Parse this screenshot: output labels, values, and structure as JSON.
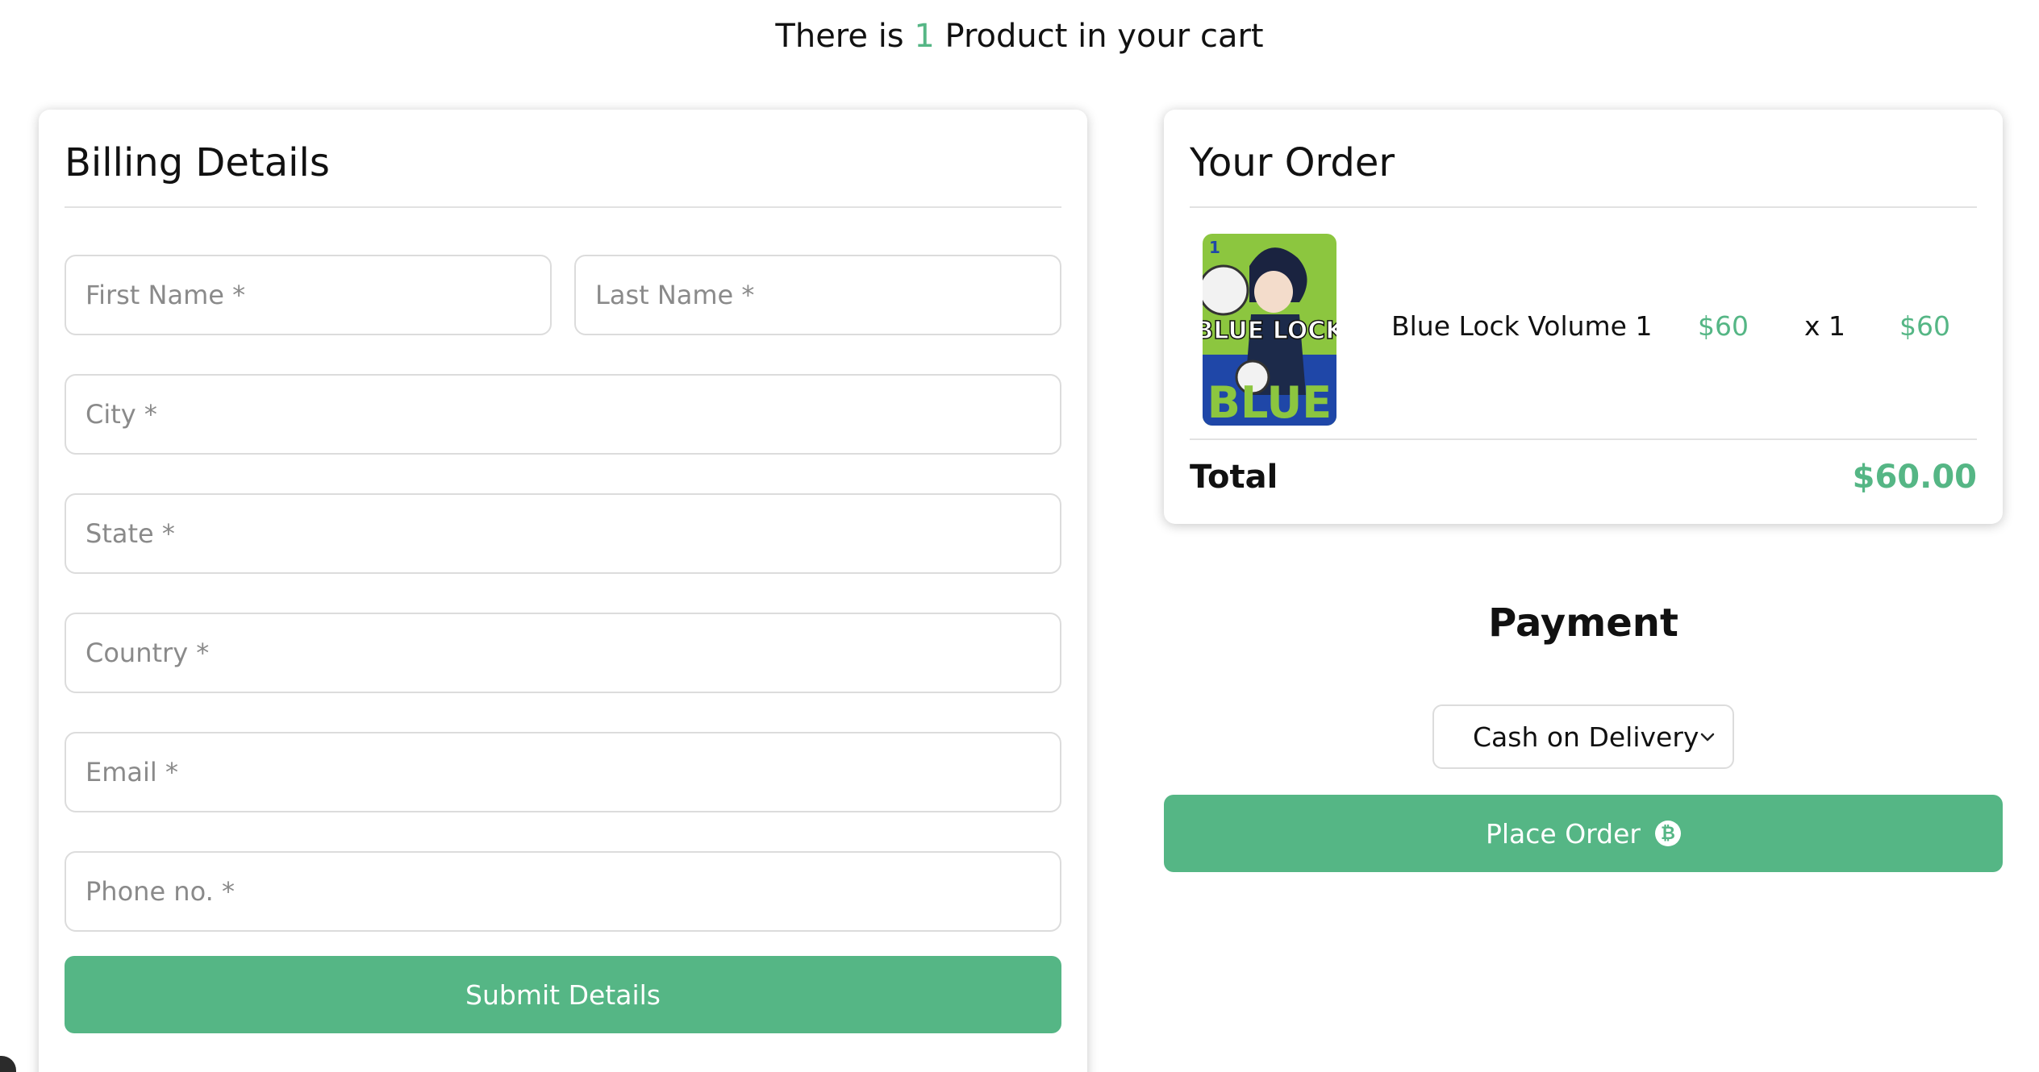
{
  "header": {
    "prefix": "There is ",
    "count": "1",
    "suffix": " Product in your cart"
  },
  "billing": {
    "title": "Billing Details",
    "fields": {
      "first_name": "First Name *",
      "last_name": "Last Name *",
      "city": "City *",
      "state": "State *",
      "country": "Country *",
      "email": "Email *",
      "phone": "Phone no. *"
    },
    "submit_label": "Submit Details"
  },
  "order": {
    "title": "Your Order",
    "item": {
      "name": "Blue Lock Volume 1",
      "price": "$60",
      "quantity": "x 1",
      "subtotal": "$60",
      "cover_text_top": "BLUE LOCK",
      "cover_text_bottom": "BLUE",
      "cover_volume": "1"
    },
    "total_label": "Total",
    "total_value": "$60.00"
  },
  "payment": {
    "title": "Payment",
    "selected_method": "Cash on Delivery",
    "place_order_label": "Place Order",
    "place_order_icon": "bitcoin-icon"
  },
  "colors": {
    "accent": "#55b685",
    "border": "#dcdcdc"
  }
}
